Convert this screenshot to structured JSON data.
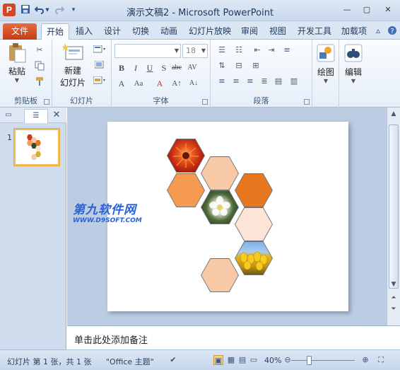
{
  "window": {
    "title": "演示文稿2 - Microsoft PowerPoint",
    "app_icon_letter": "P"
  },
  "quick_access": {
    "save_icon": "save-icon",
    "undo_icon": "undo-icon",
    "redo_icon": "redo-icon",
    "customize_icon": "customize-icon"
  },
  "tabs": {
    "file": "文件",
    "home": "开始",
    "insert": "插入",
    "design": "设计",
    "transitions": "切换",
    "animations": "动画",
    "slideshow": "幻灯片放映",
    "review": "审阅",
    "view": "视图",
    "developer": "开发工具",
    "addins": "加载项"
  },
  "ribbon": {
    "clipboard": {
      "paste": "粘贴",
      "label": "剪贴板"
    },
    "slides": {
      "new_slide_line1": "新建",
      "new_slide_line2": "幻灯片",
      "label": "幻灯片"
    },
    "font": {
      "size_value": "18",
      "label": "字体"
    },
    "paragraph": {
      "label": "段落"
    },
    "drawing": {
      "label": "绘图"
    },
    "editing": {
      "label": "编辑"
    }
  },
  "left_panel": {
    "slide_number": "1"
  },
  "watermark": {
    "line1": "第九软件网",
    "line2": "WWW.D9SOFT.COM"
  },
  "notes": {
    "placeholder": "单击此处添加备注"
  },
  "status_bar": {
    "slide_info": "幻灯片 第 1 张，共 1 张",
    "theme": "\"Office 主题\"",
    "zoom": "40%"
  },
  "colors": {
    "file_tab": "#d24726",
    "hex_light": "#f8c9a7",
    "hex_mid": "#f59a4f",
    "hex_dark": "#e8781f",
    "hex_pale": "#fce5d7"
  }
}
